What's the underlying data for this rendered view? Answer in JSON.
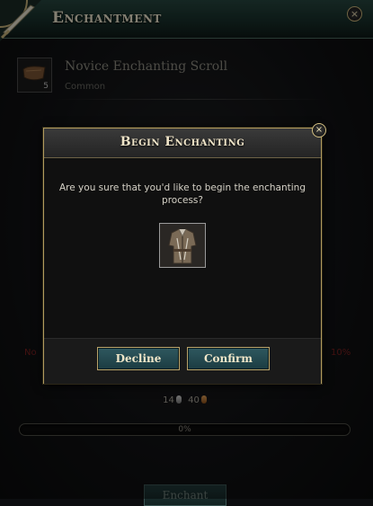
{
  "window": {
    "title": "Enchantment",
    "close_icon": "×"
  },
  "item": {
    "name": "Novice Enchanting Scroll",
    "rarity": "Common",
    "quantity": "5",
    "icon": "scroll-icon"
  },
  "enchant_panel": {
    "fail_left": "No",
    "fail_right": "10%",
    "cost_silver": "14",
    "cost_copper": "40",
    "progress_label": "0%",
    "progress_value": 0,
    "enchant_button": "Enchant"
  },
  "dialog": {
    "title": "Begin Enchanting",
    "close_icon": "×",
    "message": "Are you sure that you'd like to begin the enchanting process?",
    "item_icon": "armor-icon",
    "decline_label": "Decline",
    "confirm_label": "Confirm"
  },
  "colors": {
    "header_teal": "#27463f",
    "button_teal": "#2f5960",
    "gold_border": "#b19b5e",
    "fail_red": "#7a2020"
  }
}
